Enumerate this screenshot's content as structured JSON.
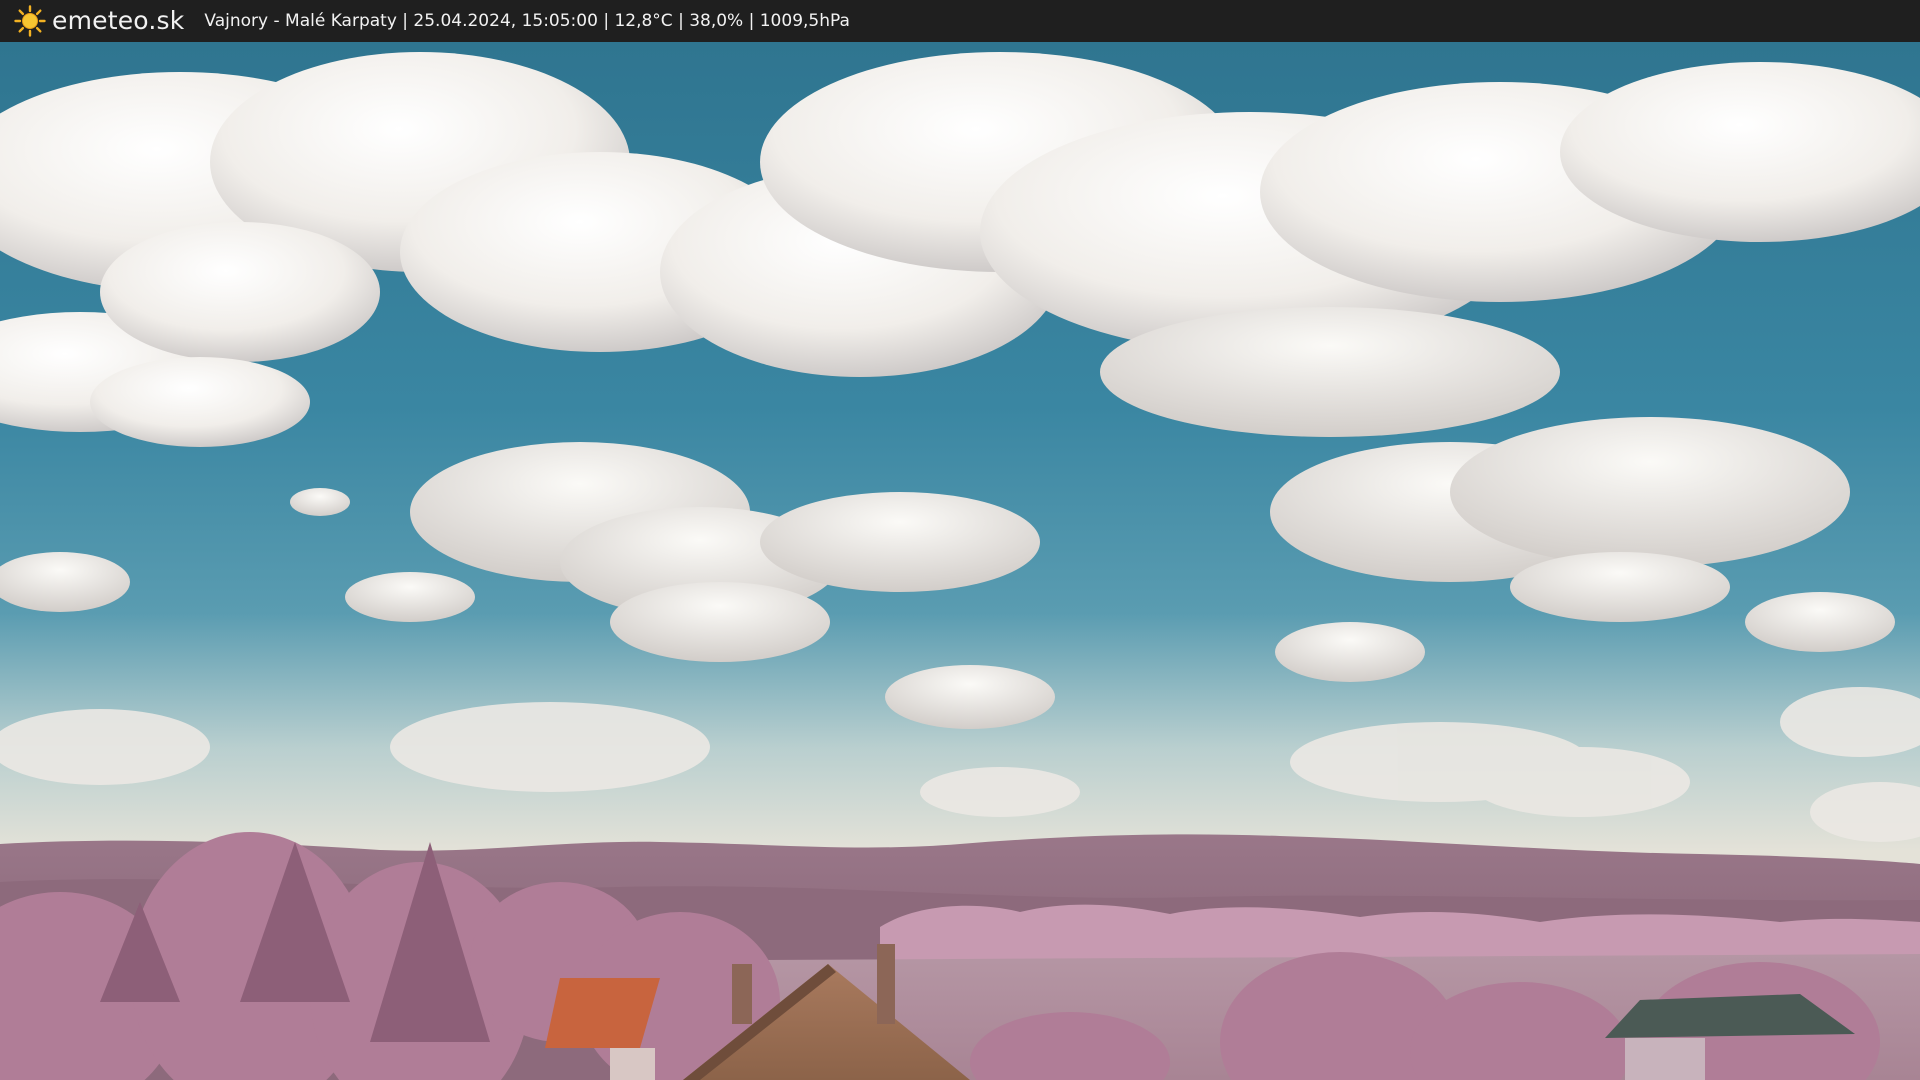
{
  "header": {
    "logo_text": "emeteo.sk",
    "logo_icon": "sun-icon",
    "station_info": "Vajnory - Malé Karpaty | 25.04.2024, 15:05:00 | 12,8°C | 38,0% | 1009,5hPa"
  },
  "colors": {
    "header_bg": "#1f1f1f",
    "sky": "#3f8aa6",
    "cloud": "#f4f1ec",
    "foliage": "#b27f98",
    "roof": "#c86f44"
  }
}
